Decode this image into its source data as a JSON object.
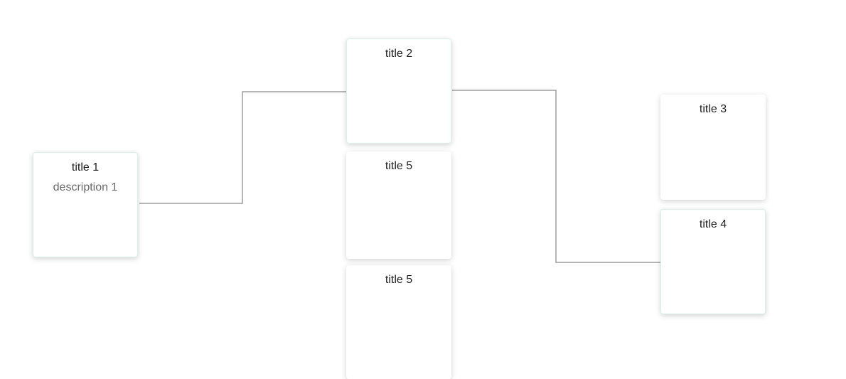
{
  "nodes": [
    {
      "id": "1",
      "title": "title 1",
      "description": "description 1"
    },
    {
      "id": "2",
      "title": "title 2"
    },
    {
      "id": "3",
      "title": "title 3"
    },
    {
      "id": "4",
      "title": "title 4"
    },
    {
      "id": "5a",
      "title": "title 5"
    },
    {
      "id": "5b",
      "title": "title 5"
    }
  ],
  "edges": [
    {
      "from": "1",
      "to": "2"
    },
    {
      "from": "2",
      "to": "4"
    }
  ],
  "colors": {
    "connector": "#9e9e9e",
    "title_text": "#222222",
    "description_text": "#6b6b6b",
    "active_border": "#d9f2e6"
  }
}
